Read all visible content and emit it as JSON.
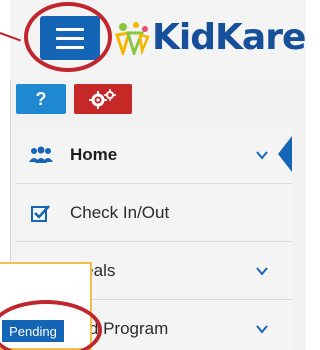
{
  "logo": {
    "text": "KidKare"
  },
  "toolbar": {
    "help_label": "?"
  },
  "menu": {
    "items": [
      {
        "label": "Home",
        "icon": "people-icon"
      },
      {
        "label": "Check In/Out",
        "icon": "checkbox-icon"
      },
      {
        "label": "Meals",
        "icon": "fork-knife-icon"
      },
      {
        "label": "Food Program",
        "visible_label": "ood Program",
        "icon": "apple-icon"
      }
    ]
  },
  "status": {
    "pending_label": "Pending"
  },
  "colors": {
    "brand_blue": "#1565b7",
    "help_blue": "#1e88d0",
    "gear_red": "#c62828",
    "highlight_red": "#c0262d",
    "popover_border": "#f0c14a"
  }
}
